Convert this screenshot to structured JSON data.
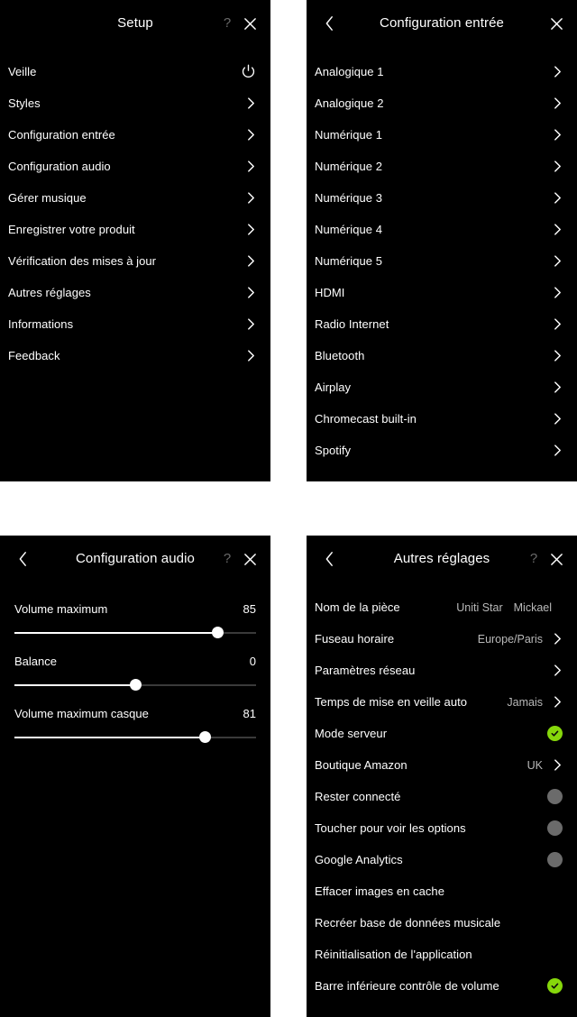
{
  "panels": {
    "setup": {
      "title": "Setup",
      "help_label": "?",
      "close_label": "✕",
      "items": [
        {
          "label": "Veille",
          "accessory": "power"
        },
        {
          "label": "Styles",
          "accessory": "chevron"
        },
        {
          "label": "Configuration entrée",
          "accessory": "chevron"
        },
        {
          "label": "Configuration audio",
          "accessory": "chevron"
        },
        {
          "label": "Gérer musique",
          "accessory": "chevron"
        },
        {
          "label": "Enregistrer votre produit",
          "accessory": "chevron"
        },
        {
          "label": "Vérification des mises à jour",
          "accessory": "chevron"
        },
        {
          "label": "Autres réglages",
          "accessory": "chevron"
        },
        {
          "label": "Informations",
          "accessory": "chevron"
        },
        {
          "label": "Feedback",
          "accessory": "chevron"
        }
      ]
    },
    "input": {
      "title": "Configuration entrée",
      "back_label": "‹",
      "close_label": "✕",
      "items": [
        {
          "label": "Analogique 1",
          "accessory": "chevron"
        },
        {
          "label": "Analogique 2",
          "accessory": "chevron"
        },
        {
          "label": "Numérique 1",
          "accessory": "chevron"
        },
        {
          "label": "Numérique 2",
          "accessory": "chevron"
        },
        {
          "label": "Numérique 3",
          "accessory": "chevron"
        },
        {
          "label": "Numérique 4",
          "accessory": "chevron"
        },
        {
          "label": "Numérique 5",
          "accessory": "chevron"
        },
        {
          "label": "HDMI",
          "accessory": "chevron"
        },
        {
          "label": "Radio Internet",
          "accessory": "chevron"
        },
        {
          "label": "Bluetooth",
          "accessory": "chevron"
        },
        {
          "label": "Airplay",
          "accessory": "chevron"
        },
        {
          "label": "Chromecast built-in",
          "accessory": "chevron"
        },
        {
          "label": "Spotify",
          "accessory": "chevron"
        }
      ]
    },
    "audio": {
      "title": "Configuration audio",
      "back_label": "‹",
      "help_label": "?",
      "close_label": "✕",
      "sliders": [
        {
          "label": "Volume maximum",
          "value": "85",
          "percent": 84
        },
        {
          "label": "Balance",
          "value": "0",
          "percent": 50
        },
        {
          "label": "Volume maximum casque",
          "value": "81",
          "percent": 79
        }
      ]
    },
    "other": {
      "title": "Autres réglages",
      "back_label": "‹",
      "help_label": "?",
      "close_label": "✕",
      "items": [
        {
          "label": "Nom de la pièce",
          "value": "Uniti Star",
          "value2": "Mickael",
          "accessory": "none"
        },
        {
          "label": "Fuseau horaire",
          "value": "Europe/Paris",
          "accessory": "chevron"
        },
        {
          "label": "Paramètres réseau",
          "value": "",
          "accessory": "chevron"
        },
        {
          "label": "Temps de mise en veille auto",
          "value": "Jamais",
          "accessory": "chevron"
        },
        {
          "label": "Mode serveur",
          "value": "",
          "accessory": "check"
        },
        {
          "label": "Boutique Amazon",
          "value": "UK",
          "accessory": "chevron"
        },
        {
          "label": "Rester connecté",
          "value": "",
          "accessory": "dot"
        },
        {
          "label": "Toucher pour voir les options",
          "value": "",
          "accessory": "dot"
        },
        {
          "label": "Google Analytics",
          "value": "",
          "accessory": "dot"
        },
        {
          "label": "Effacer images en cache",
          "value": "",
          "accessory": "none"
        },
        {
          "label": "Recréer base de données musicale",
          "value": "",
          "accessory": "none"
        },
        {
          "label": "Réinitialisation de l'application",
          "value": "",
          "accessory": "none"
        },
        {
          "label": "Barre inférieure contrôle de volume",
          "value": "",
          "accessory": "check"
        }
      ]
    }
  },
  "colors": {
    "background": "#000000",
    "text": "#ffffff",
    "muted": "#b9b9b9",
    "accent_green": "#86d70b",
    "toggle_off": "#6b6b6b"
  }
}
